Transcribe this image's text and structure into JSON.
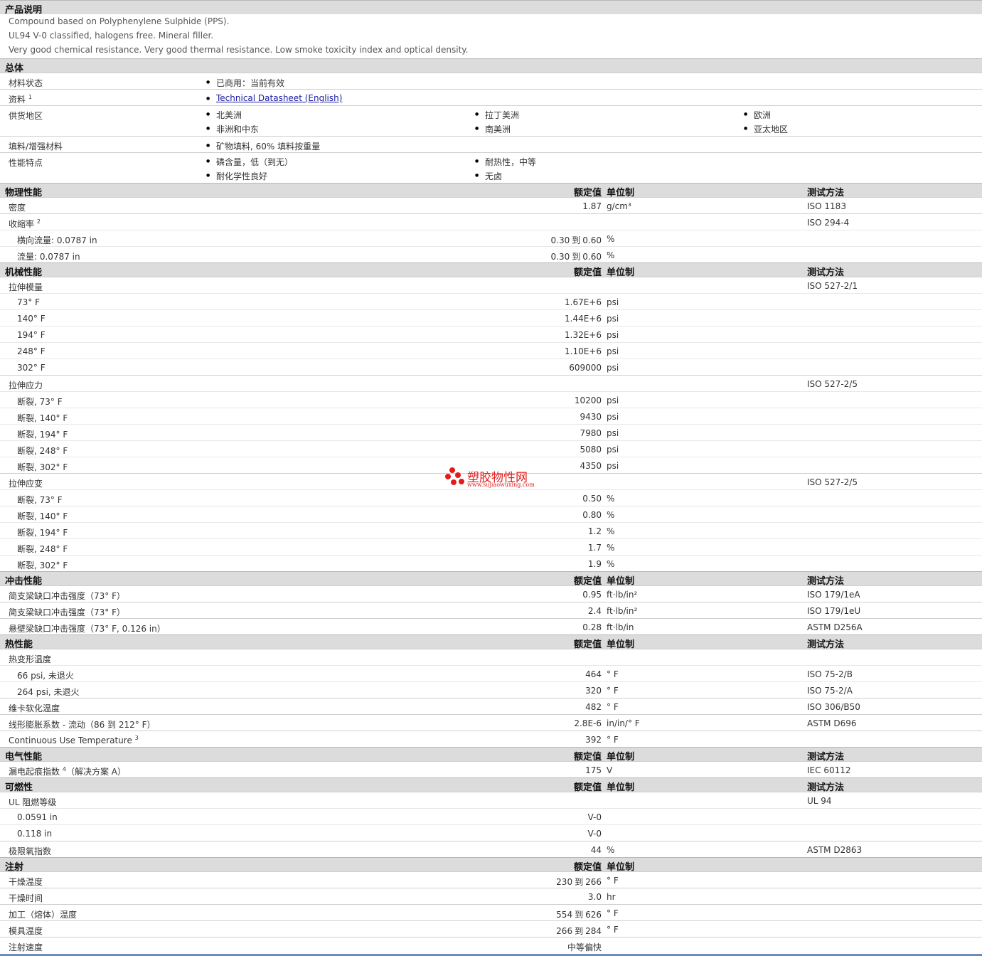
{
  "headers": {
    "value": "额定值",
    "unit": "单位制",
    "test": "测试方法"
  },
  "description": {
    "title": "产品说明",
    "lines": [
      "Compound based on Polyphenylene Sulphide (PPS).",
      "UL94 V-0 classified, halogens free. Mineral filler.",
      "Very good chemical resistance. Very good thermal resistance. Low smoke toxicity index and optical density."
    ]
  },
  "general": {
    "title": "总体",
    "rows": [
      {
        "label": "材料状态",
        "items": [
          "已商用：当前有效"
        ]
      },
      {
        "label": "资料",
        "sup": "1",
        "items": [
          "Technical Datasheet (English)"
        ]
      },
      {
        "label": "供货地区",
        "items": [
          "北美洲",
          "拉丁美洲",
          "欧洲",
          "非洲和中东",
          "南美洲",
          "亚太地区"
        ]
      },
      {
        "label": "填料/增强材料",
        "items": [
          "矿物填料, 60% 填料按重量"
        ]
      },
      {
        "label": "性能特点",
        "items": [
          "磷含量，低（到无）",
          "耐热性，中等",
          "耐化学性良好",
          "无卤"
        ]
      }
    ]
  },
  "sections": [
    {
      "title": "物理性能",
      "rows": [
        {
          "label": "密度",
          "value": "1.87",
          "unit": "g/cm³",
          "test": "ISO 1183"
        },
        {
          "label": "收缩率",
          "sup": "2",
          "test": "ISO 294-4"
        },
        {
          "label": "横向流量: 0.0787 in",
          "sub": true,
          "value": "0.30",
          "value2": "0.60",
          "unit": "%"
        },
        {
          "label": "流量: 0.0787 in",
          "sub": true,
          "value": "0.30",
          "value2": "0.60",
          "unit": "%"
        }
      ]
    },
    {
      "title": "机械性能",
      "rows": [
        {
          "label": "拉伸模量",
          "test": "ISO 527-2/1"
        },
        {
          "label": "73° F",
          "sub": true,
          "value": "1.67E+6",
          "unit": "psi"
        },
        {
          "label": "140° F",
          "sub": true,
          "value": "1.44E+6",
          "unit": "psi"
        },
        {
          "label": "194° F",
          "sub": true,
          "value": "1.32E+6",
          "unit": "psi"
        },
        {
          "label": "248° F",
          "sub": true,
          "value": "1.10E+6",
          "unit": "psi"
        },
        {
          "label": "302° F",
          "sub": true,
          "value": "609000",
          "unit": "psi"
        },
        {
          "label": "拉伸应力",
          "test": "ISO 527-2/5"
        },
        {
          "label": "断裂, 73° F",
          "sub": true,
          "value": "10200",
          "unit": "psi"
        },
        {
          "label": "断裂, 140° F",
          "sub": true,
          "value": "9430",
          "unit": "psi"
        },
        {
          "label": "断裂, 194° F",
          "sub": true,
          "value": "7980",
          "unit": "psi"
        },
        {
          "label": "断裂, 248° F",
          "sub": true,
          "value": "5080",
          "unit": "psi"
        },
        {
          "label": "断裂, 302° F",
          "sub": true,
          "value": "4350",
          "unit": "psi"
        },
        {
          "label": "拉伸应变",
          "test": "ISO 527-2/5"
        },
        {
          "label": "断裂, 73° F",
          "sub": true,
          "value": "0.50",
          "unit": "%"
        },
        {
          "label": "断裂, 140° F",
          "sub": true,
          "value": "0.80",
          "unit": "%"
        },
        {
          "label": "断裂, 194° F",
          "sub": true,
          "value": "1.2",
          "unit": "%"
        },
        {
          "label": "断裂, 248° F",
          "sub": true,
          "value": "1.7",
          "unit": "%"
        },
        {
          "label": "断裂, 302° F",
          "sub": true,
          "value": "1.9",
          "unit": "%"
        }
      ]
    },
    {
      "title": "冲击性能",
      "rows": [
        {
          "label": "简支梁缺口冲击强度（73° F）",
          "value": "0.95",
          "unit": "ft·lb/in²",
          "test": "ISO 179/1eA"
        },
        {
          "label": "简支梁缺口冲击强度（73° F）",
          "value": "2.4",
          "unit": "ft·lb/in²",
          "test": "ISO 179/1eU"
        },
        {
          "label": "悬壁梁缺口冲击强度（73° F, 0.126 in）",
          "value": "0.28",
          "unit": "ft·lb/in",
          "test": "ASTM D256A"
        }
      ]
    },
    {
      "title": "热性能",
      "rows": [
        {
          "label": "热变形温度"
        },
        {
          "label": "66 psi, 未退火",
          "sub": true,
          "value": "464",
          "unit": "° F",
          "test": "ISO 75-2/B"
        },
        {
          "label": "264 psi, 未退火",
          "sub": true,
          "value": "320",
          "unit": "° F",
          "test": "ISO 75-2/A"
        },
        {
          "label": "维卡软化温度",
          "value": "482",
          "unit": "° F",
          "test": "ISO 306/B50"
        },
        {
          "label": "线形膨胀系数 - 流动（86 到 212° F）",
          "value": "2.8E-6",
          "unit": "in/in/° F",
          "test": "ASTM D696"
        },
        {
          "label": "Continuous Use Temperature",
          "sup": "3",
          "value": "392",
          "unit": "° F"
        }
      ]
    },
    {
      "title": "电气性能",
      "rows": [
        {
          "label": "漏电起痕指数",
          "sup": "4",
          "suffix": "（解决方案 A）",
          "value": "175",
          "unit": "V",
          "test": "IEC 60112"
        }
      ]
    },
    {
      "title": "可燃性",
      "rows": [
        {
          "label": "UL 阻燃等级",
          "test": "UL 94"
        },
        {
          "label": "0.0591 in",
          "sub": true,
          "value": "V-0"
        },
        {
          "label": "0.118 in",
          "sub": true,
          "value": "V-0"
        },
        {
          "label": "极限氧指数",
          "value": "44",
          "unit": "%",
          "test": "ASTM D2863"
        }
      ]
    },
    {
      "title": "注射",
      "noTest": true,
      "rows": [
        {
          "label": "干燥温度",
          "value": "230",
          "value2": "266",
          "unit": "° F"
        },
        {
          "label": "干燥时间",
          "value": "3.0",
          "unit": "hr"
        },
        {
          "label": "加工（熔体）温度",
          "value": "554",
          "value2": "626",
          "unit": "° F"
        },
        {
          "label": "模具温度",
          "value": "266",
          "value2": "284",
          "unit": "° F"
        },
        {
          "label": "注射速度",
          "value": "中等偏快"
        }
      ]
    }
  ],
  "range_word": "到",
  "watermark": {
    "title": "塑胶物性网",
    "url": "www.sujiaowuxing.com"
  }
}
